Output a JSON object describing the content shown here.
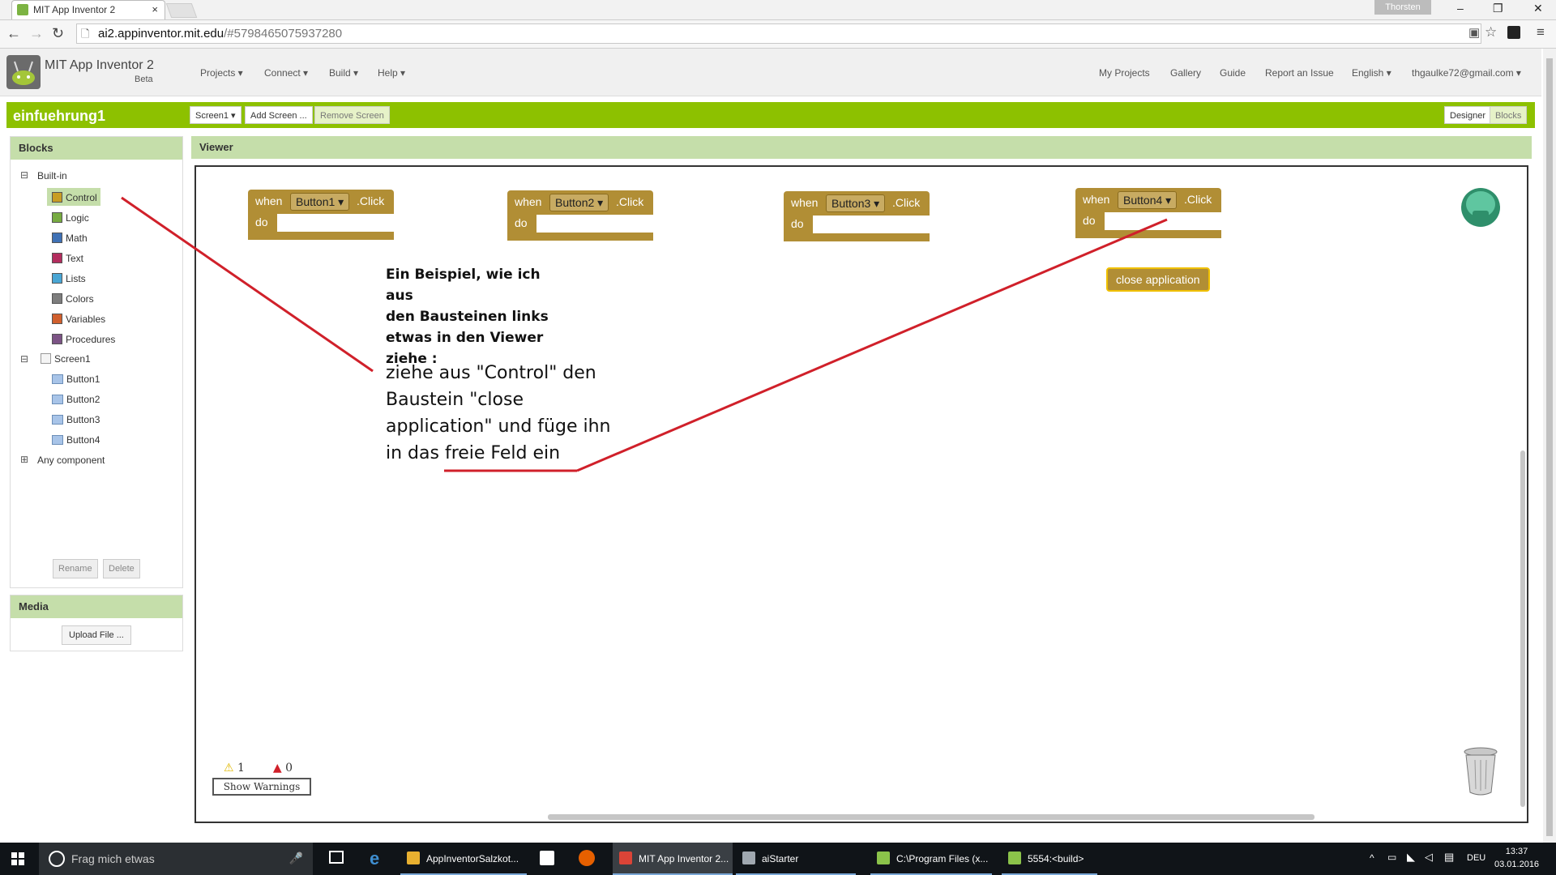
{
  "browser": {
    "tab_title": "MIT App Inventor 2",
    "tab_close": "×",
    "profile_name": "Thorsten",
    "url_host": "ai2.appinventor.mit.edu",
    "url_path": "/#5798465075937280",
    "window_controls": {
      "minimize": "–",
      "restore": "❐",
      "close": "✕"
    }
  },
  "app": {
    "name": "MIT App Inventor 2",
    "beta": "Beta",
    "menu": [
      "Projects ▾",
      "Connect ▾",
      "Build ▾",
      "Help ▾"
    ],
    "right_menu": [
      "My Projects",
      "Gallery",
      "Guide",
      "Report an Issue",
      "English ▾",
      "thgaulke72@gmail.com ▾"
    ]
  },
  "project": {
    "name": "einfuehrung1",
    "screen_button": "Screen1 ▾",
    "add_screen": "Add Screen ...",
    "remove_screen": "Remove Screen",
    "designer": "Designer",
    "blocks": "Blocks"
  },
  "blocks_panel": {
    "title": "Blocks",
    "builtin_label": "Built-in",
    "builtin": [
      {
        "label": "Control",
        "color": "#c89d23"
      },
      {
        "label": "Logic",
        "color": "#77ab41"
      },
      {
        "label": "Math",
        "color": "#3f71b5"
      },
      {
        "label": "Text",
        "color": "#b32d5e"
      },
      {
        "label": "Lists",
        "color": "#49a6d4"
      },
      {
        "label": "Colors",
        "color": "#7d7d7d"
      },
      {
        "label": "Variables",
        "color": "#d05f2d"
      },
      {
        "label": "Procedures",
        "color": "#7c5385"
      }
    ],
    "screen_label": "Screen1",
    "components": [
      "Button1",
      "Button2",
      "Button3",
      "Button4"
    ],
    "any_component": "Any component",
    "rename": "Rename",
    "delete": "Delete",
    "expand_minus": "⊟",
    "expand_plus": "⊞"
  },
  "media_panel": {
    "title": "Media",
    "upload": "Upload File ..."
  },
  "viewer": {
    "title": "Viewer",
    "blocks": [
      {
        "when": "when",
        "component": "Button1 ▾",
        "event": ".Click",
        "do": "do"
      },
      {
        "when": "when",
        "component": "Button2 ▾",
        "event": ".Click",
        "do": "do"
      },
      {
        "when": "when",
        "component": "Button3 ▾",
        "event": ".Click",
        "do": "do"
      },
      {
        "when": "when",
        "component": "Button4 ▾",
        "event": ".Click",
        "do": "do"
      }
    ],
    "close_block": "close application",
    "note_title": [
      "Ein Beispiel, wie ich aus",
      "den Bausteinen links",
      "etwas in den Viewer",
      "ziehe :"
    ],
    "note_body": [
      "ziehe aus \"Control\" den",
      "Baustein \"close",
      "application\" und füge ihn",
      "in das freie Feld ein"
    ],
    "warnings_count": "1",
    "errors_count": "0",
    "show_warnings": "Show Warnings"
  },
  "taskbar": {
    "search_placeholder": "Frag mich etwas",
    "items": [
      {
        "label": "AppInventorSalzkot...",
        "color": "#e8b030"
      },
      {
        "label": "MIT App Inventor 2...",
        "color": "#db4437"
      },
      {
        "label": "aiStarter",
        "color": "#a0a8b0"
      },
      {
        "label": "C:\\Program Files (x...",
        "color": "#8bc34a"
      },
      {
        "label": "5554:<build>",
        "color": "#8bc34a"
      }
    ],
    "lang": "DEU",
    "time": "13:37",
    "date": "03.01.2016"
  },
  "colors": {
    "accent_green": "#8dc100",
    "panel_header": "#c5deaa",
    "block_event": "#b18e35",
    "annotation_line": "#d0202a"
  }
}
